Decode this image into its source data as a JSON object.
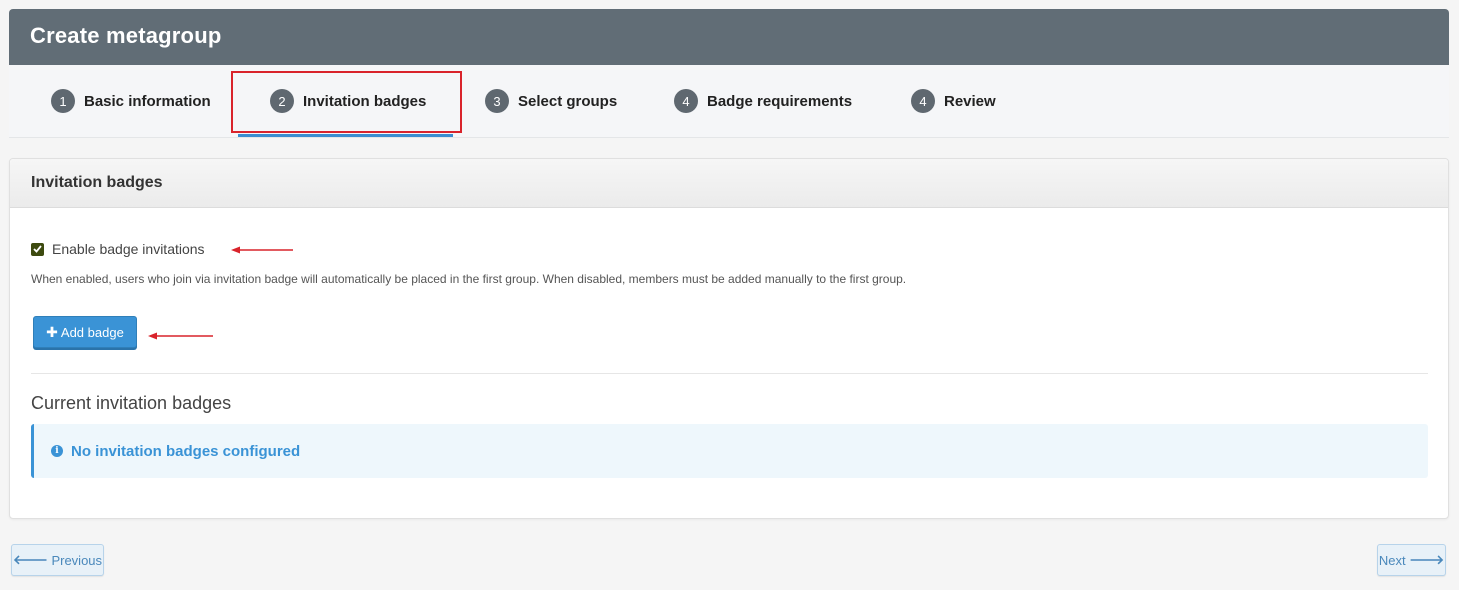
{
  "header": {
    "title": "Create metagroup"
  },
  "steps": [
    {
      "number": "1",
      "label": "Basic information"
    },
    {
      "number": "2",
      "label": "Invitation badges"
    },
    {
      "number": "3",
      "label": "Select groups"
    },
    {
      "number": "4",
      "label": "Badge requirements"
    },
    {
      "number": "4",
      "label": "Review"
    }
  ],
  "panel": {
    "title": "Invitation badges",
    "checkbox_label": "Enable badge invitations",
    "checkbox_checked": true,
    "help_text": "When enabled, users who join via invitation badge will automatically be placed in the first group. When disabled, members must be added manually to the first group.",
    "add_button": "Add badge",
    "current_title": "Current invitation badges",
    "empty_message": "No invitation badges configured",
    "info_icon": "i"
  },
  "nav": {
    "previous": "Previous",
    "next": "Next"
  },
  "colors": {
    "header_bg": "#616d76",
    "accent": "#3a93d6",
    "highlight": "#d9232b",
    "annotation_arrow": "#d9232b"
  }
}
